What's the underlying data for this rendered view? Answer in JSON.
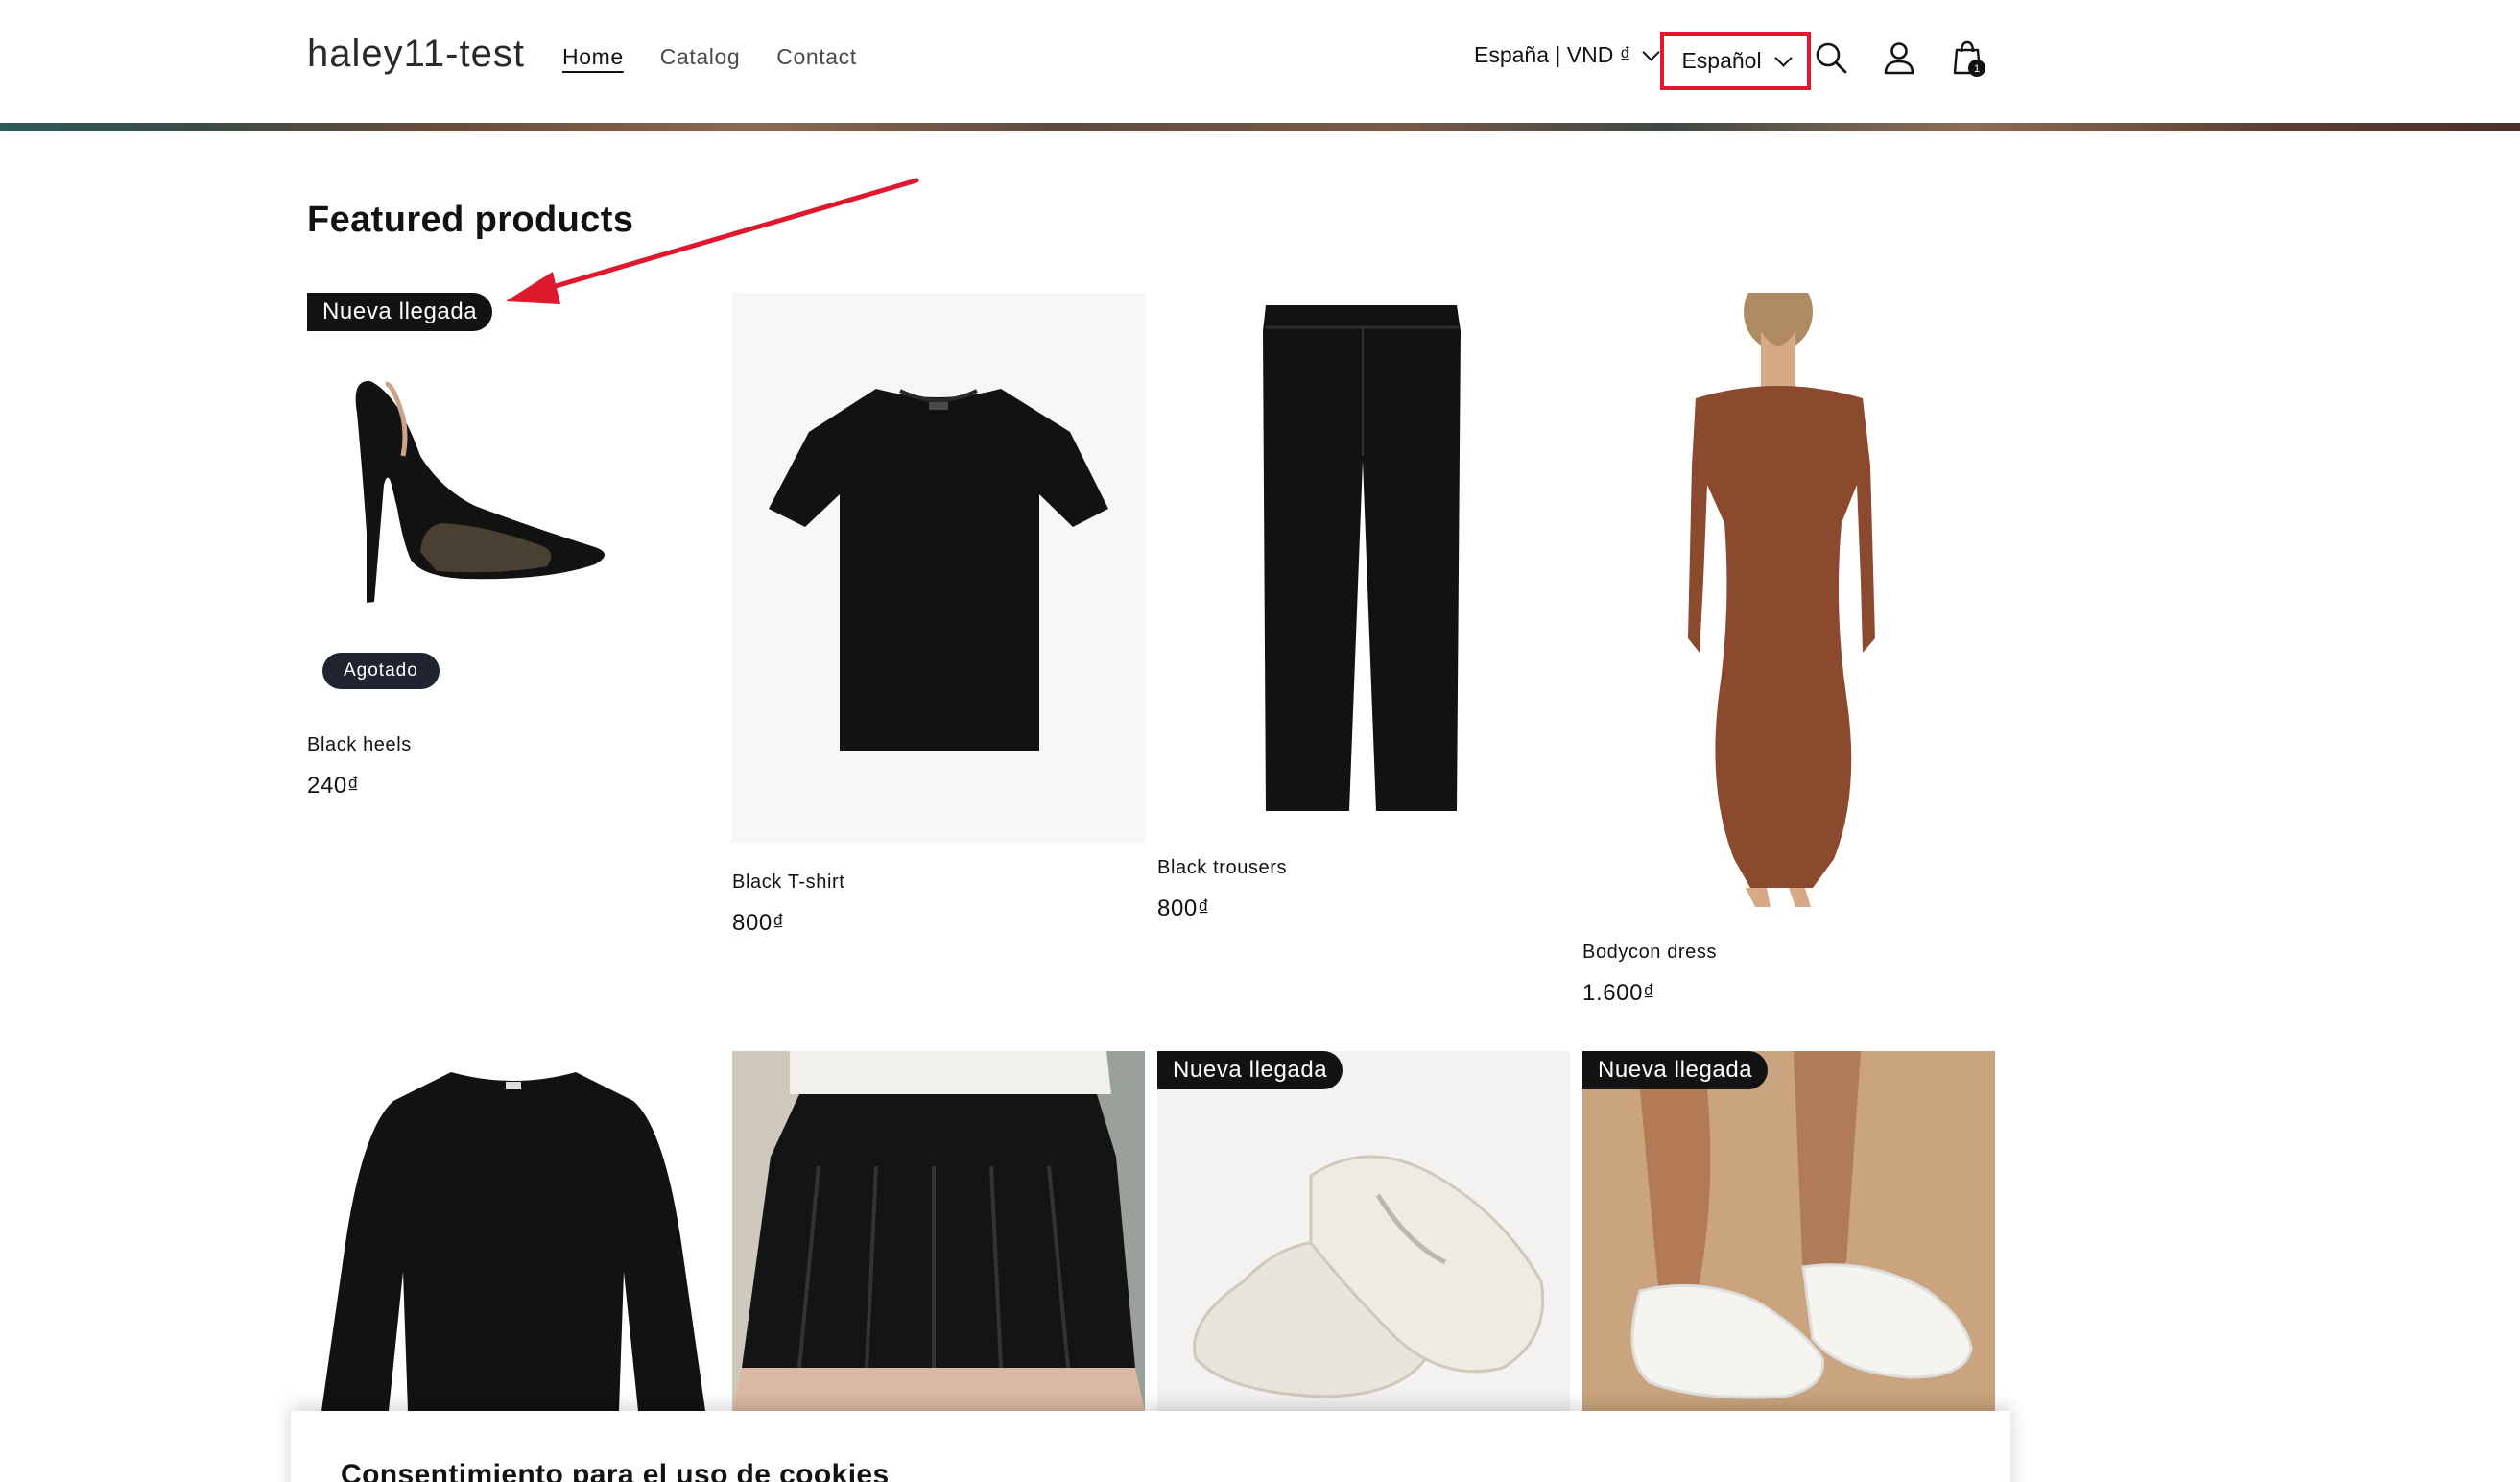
{
  "header": {
    "logo": "haley11-test",
    "nav": [
      {
        "label": "Home",
        "active": true
      },
      {
        "label": "Catalog",
        "active": false
      },
      {
        "label": "Contact",
        "active": false
      }
    ],
    "country_currency": "España | VND ₫",
    "language": "Español",
    "cart_count": "1",
    "icons": [
      "search-icon",
      "account-icon",
      "cart-icon",
      "chevron-down-icon"
    ]
  },
  "section": {
    "title": "Featured products"
  },
  "products": [
    {
      "title": "Black heels",
      "price": "240₫",
      "badge": "Nueva llegada",
      "status": "Agotado"
    },
    {
      "title": "Black T-shirt",
      "price": "800₫",
      "badge": "",
      "status": ""
    },
    {
      "title": "Black trousers",
      "price": "800₫",
      "badge": "",
      "status": ""
    },
    {
      "title": "Bodycon dress",
      "price": "1.600₫",
      "badge": "",
      "status": ""
    },
    {
      "title": "",
      "price": "",
      "badge": "",
      "status": ""
    },
    {
      "title": "",
      "price": "",
      "badge": "",
      "status": ""
    },
    {
      "title": "",
      "price": "",
      "badge": "Nueva llegada",
      "status": ""
    },
    {
      "title": "",
      "price": "",
      "badge": "Nueva llegada",
      "status": ""
    }
  ],
  "cookie": {
    "title": "Consentimiento para el uso de cookies"
  },
  "colors": {
    "annotation": "#e0182d",
    "badge_bg": "#121212",
    "sold_out_bg": "#1f2430"
  }
}
